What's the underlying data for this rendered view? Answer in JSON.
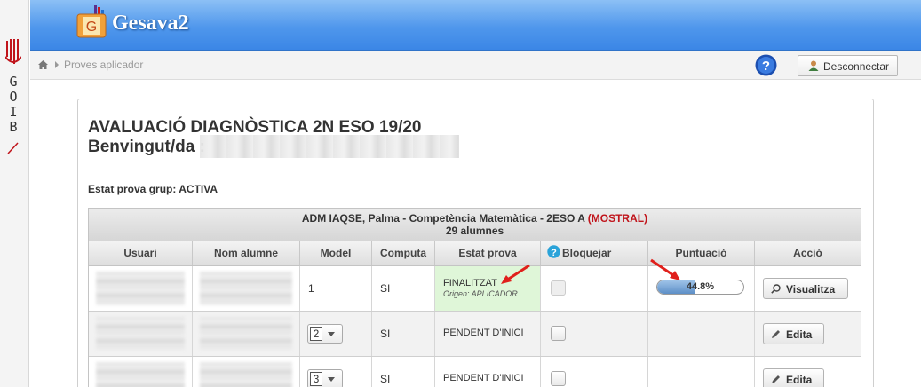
{
  "sidebar": {
    "letters": [
      "G",
      "O",
      "I",
      "B"
    ]
  },
  "header": {
    "app_name": "Gesava2",
    "logo_letter": "G",
    "brand_color": "#4f97ec"
  },
  "breadcrumb": {
    "current": "Proves aplicador"
  },
  "toolbar": {
    "logout_label": "Desconnectar"
  },
  "page": {
    "title": "AVALUACIÓ DIAGNÒSTICA 2N ESO 19/20",
    "welcome_label": "Benvingut/da :",
    "group_status": "Estat prova grup: ACTIVA"
  },
  "table": {
    "caption_main": "ADM IAQSE, Palma - Competència Matemàtica - 2ESO A ",
    "caption_tag": "(MOSTRAL)",
    "caption_count": "29 alumnes",
    "columns": [
      "Usuari",
      "Nom alumne",
      "Model",
      "Computa",
      "Estat prova",
      "Bloquejar",
      "Puntuació",
      "Acció"
    ],
    "rows": [
      {
        "model": "1",
        "computa": "SI",
        "estat": "FINALITZAT",
        "origen": "Origen: APLICADOR",
        "score_label": "44.8%",
        "score_fraction": 0.448,
        "action": "Visualitza"
      },
      {
        "model": "2",
        "computa": "SI",
        "estat": "PENDENT D'INICI",
        "action": "Edita"
      },
      {
        "model": "3",
        "computa": "SI",
        "estat": "PENDENT D'INICI",
        "action": "Edita"
      }
    ]
  },
  "colors": {
    "finished_bg": "#dff6d8",
    "mostral_red": "#c0141b",
    "annotation_arrow": "#e0201c"
  }
}
